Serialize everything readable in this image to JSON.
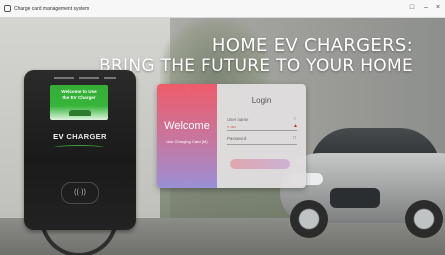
{
  "window": {
    "title": "Charge card management system"
  },
  "headline": {
    "line1": "HOME EV CHARGERS:",
    "line2": "BRING THE FUTURE TO YOUR HOME"
  },
  "charger": {
    "screen_line1": "Welcome to Use",
    "screen_line2": "the EV Charger",
    "brand_ev": "EV",
    "brand_rest": " CHARGER",
    "nfc_symbol": "((·))"
  },
  "login_card": {
    "left": {
      "welcome": "Welcome",
      "subtitle": "Use Charging Card (M)"
    },
    "right": {
      "title": "Login",
      "username_label": "User name",
      "username_value": "» ••••",
      "password_label": "Password"
    }
  },
  "colors": {
    "screen_green": "#37b53a",
    "card_gradient_top": "#ef5b6a",
    "card_gradient_bottom": "#9a8fd6",
    "warning_red": "#c62f2f"
  }
}
